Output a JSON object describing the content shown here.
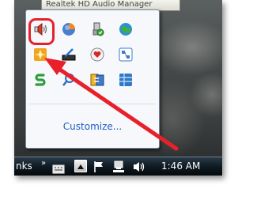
{
  "tooltip": {
    "text": "Realtek HD Audio Manager"
  },
  "tray_popup": {
    "icons": [
      {
        "name": "realtek-audio-icon",
        "label": "Realtek HD Audio Manager",
        "highlighted": true
      },
      {
        "name": "blue-orange-orb-icon"
      },
      {
        "name": "usb-safely-remove-icon"
      },
      {
        "name": "green-globe-icon"
      },
      {
        "name": "orange-starburst-icon"
      },
      {
        "name": "pen-tablet-icon"
      },
      {
        "name": "heart-chat-icon"
      },
      {
        "name": "network-monitor-icon"
      },
      {
        "name": "green-s-icon"
      },
      {
        "name": "magnifier-icon"
      },
      {
        "name": "sync-icon"
      },
      {
        "name": "blue-grid-icon"
      }
    ],
    "customize_label": "Customize..."
  },
  "taskbar": {
    "links_label": "nks",
    "chevron": "»",
    "clock": "1:46 AM"
  },
  "colors": {
    "highlight_red": "#e8202a",
    "link_blue": "#1c5fc2"
  }
}
